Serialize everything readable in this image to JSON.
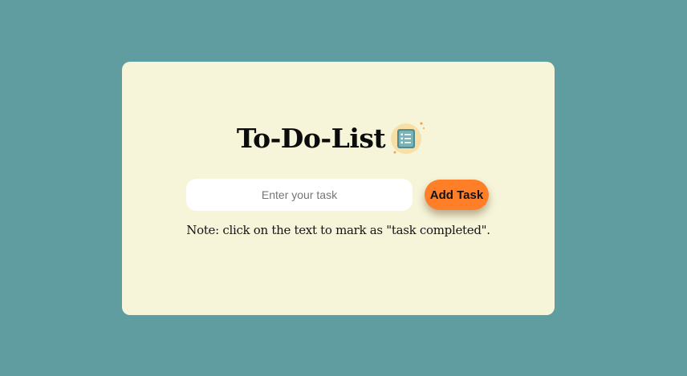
{
  "app": {
    "title": "To-Do-List",
    "title_icon": "checklist-icon"
  },
  "form": {
    "input_placeholder": "Enter your task",
    "input_value": "",
    "add_button_label": "Add Task"
  },
  "note": "Note: click on the text to mark as \"task completed\".",
  "colors": {
    "page_background": "#609da1",
    "card_background": "#f6f5da",
    "button_background": "#fe7f27",
    "input_background": "#ffffff"
  }
}
